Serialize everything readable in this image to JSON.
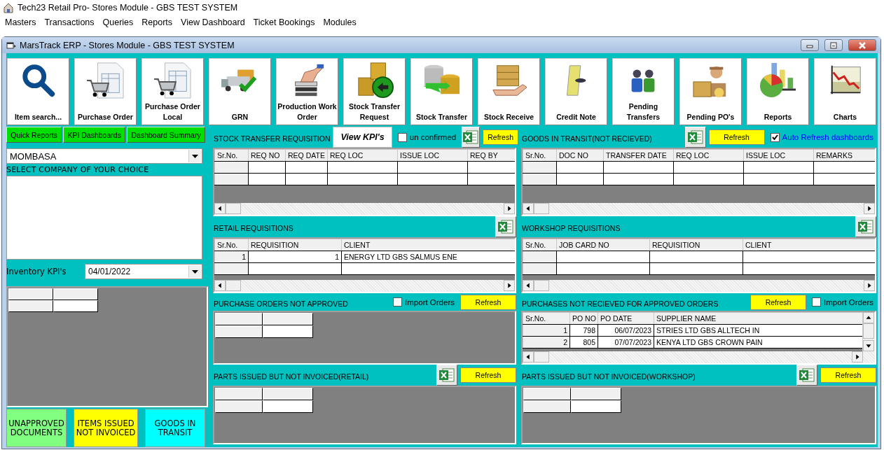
{
  "app": {
    "title": "Tech23 Retail Pro- Stores Module - GBS TEST SYSTEM"
  },
  "menu": [
    "Masters",
    "Transactions",
    "Queries",
    "Reports",
    "View Dashboard",
    "Ticket Bookings",
    "Modules"
  ],
  "window": {
    "title": "MarsTrack ERP - Stores Module - GBS TEST SYSTEM"
  },
  "toolbar": [
    {
      "label": "Item search..."
    },
    {
      "label": "Purchase Order"
    },
    {
      "label": "Purchase Order Local"
    },
    {
      "label": "GRN"
    },
    {
      "label": "Production Work Order"
    },
    {
      "label": "Stock Transfer Request"
    },
    {
      "label": "Stock Transfer"
    },
    {
      "label": "Stock Receive"
    },
    {
      "label": "Credit Note"
    },
    {
      "label": "Pending Transfers"
    },
    {
      "label": "Pending PO's"
    },
    {
      "label": "Reports"
    },
    {
      "label": "Charts"
    }
  ],
  "left_panel": {
    "buttons": [
      "Quick Reports",
      "KPI Dashboards",
      "Dashboard Summary"
    ],
    "company": {
      "value": "MOMBASA"
    },
    "company_label": "SELECT COMPANY OF YOUR CHOICE",
    "kpi_label": "Inventory KPI's",
    "kpi_date": {
      "value": "04/01/2022"
    },
    "tiles": [
      {
        "label": "UNAPPROVED DOCUMENTS",
        "color": "#80ff80"
      },
      {
        "label": "ITEMS ISSUED NOT INVOICED",
        "color": "#ffff00"
      },
      {
        "label": "GOODS IN TRANSIT",
        "color": "#00ffff"
      }
    ]
  },
  "panels": [
    {
      "title": "STOCK TRANSFER REQUISITION",
      "controls": [
        {
          "kind": "button",
          "label": "View KPI's"
        },
        {
          "kind": "checkbox",
          "label": "un confirmed",
          "checked": false
        },
        {
          "kind": "excel"
        },
        {
          "kind": "refresh",
          "label": "Refresh"
        }
      ],
      "grid": {
        "kind": "table",
        "columns": [
          "Sr.No.",
          "REQ NO",
          "REQ DATE",
          "REQ LOC",
          "ISSUE LOC",
          "REQ BY"
        ],
        "rows": [
          [
            "",
            "",
            "",
            "",
            "",
            ""
          ],
          [
            "",
            "",
            "",
            "",
            "",
            ""
          ]
        ]
      }
    },
    {
      "title": "GOODS IN TRANSIT(NOT RECIEVED)",
      "controls": [
        {
          "kind": "excel"
        },
        {
          "kind": "refresh",
          "label": "Refresh"
        },
        {
          "kind": "checkbox",
          "label": "Auto Refresh dashboards",
          "checked": true
        }
      ],
      "grid": {
        "kind": "table",
        "columns": [
          "Sr.No.",
          "DOC NO",
          "TRANSFER DATE",
          "REQ LOC",
          "ISSUE LOC",
          "REMARKS"
        ],
        "rows": [
          [
            "",
            "",
            "",
            "",
            "",
            ""
          ],
          [
            "",
            "",
            "",
            "",
            "",
            ""
          ]
        ]
      }
    },
    {
      "title": "RETAIL REQUISITIONS",
      "controls": [
        {
          "kind": "excel"
        }
      ],
      "grid": {
        "kind": "table",
        "columns": [
          "Sr.No.",
          "REQUISITION",
          "CLIENT"
        ],
        "rows": [
          [
            "1",
            "1",
            "ENERGY LTD GBS SALMUS ENE"
          ],
          [
            "",
            "",
            ""
          ]
        ]
      }
    },
    {
      "title": "WORKSHOP REQUISITIONS",
      "controls": [
        {
          "kind": "excel"
        }
      ],
      "grid": {
        "kind": "table",
        "columns": [
          "Sr.No.",
          "JOB CARD NO",
          "REQUISITION",
          "CLIENT"
        ],
        "rows": [
          [
            "",
            "",
            "",
            ""
          ],
          [
            "",
            "",
            "",
            ""
          ]
        ]
      }
    },
    {
      "title": "PURCHASE ORDERS NOT APPROVED",
      "controls": [
        {
          "kind": "checkbox",
          "label": "Import Orders",
          "checked": false
        },
        {
          "kind": "refresh",
          "label": "Refresh"
        }
      ],
      "grid": {
        "kind": "blank"
      }
    },
    {
      "title": "PURCHASES NOT RECIEVED FOR APPROVED ORDERS",
      "controls": [
        {
          "kind": "refresh",
          "label": "Refresh"
        },
        {
          "kind": "checkbox",
          "label": "Import Orders",
          "checked": false
        }
      ],
      "grid": {
        "kind": "scroll_table",
        "columns": [
          "Sr.No.",
          "PO NO",
          "PO DATE",
          "SUPPLIER NAME"
        ],
        "rows": [
          [
            "1",
            "798",
            "06/07/2023",
            "STRIES LTD GBS ALLTECH IN"
          ],
          [
            "2",
            "805",
            "07/07/2023",
            " KENYA LTD GBS CROWN PAIN"
          ]
        ]
      }
    },
    {
      "title": "PARTS ISSUED BUT NOT INVOICED(RETAIL)",
      "controls": [
        {
          "kind": "excel"
        },
        {
          "kind": "refresh",
          "label": "Refresh"
        }
      ],
      "grid": {
        "kind": "blank"
      }
    },
    {
      "title": "PARTS ISSUED BUT NOT INVOICED(WORKSHOP)",
      "controls": [
        {
          "kind": "excel"
        },
        {
          "kind": "refresh",
          "label": "Refresh"
        }
      ],
      "grid": {
        "kind": "blank"
      }
    }
  ]
}
